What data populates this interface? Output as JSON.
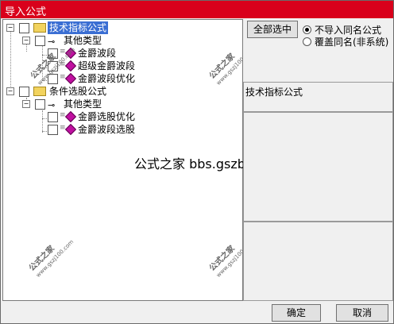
{
  "window": {
    "title": "导入公式"
  },
  "tree": {
    "groups": [
      {
        "label": "技术指标公式",
        "subgroup": "其他类型",
        "items": [
          "金爵波段",
          "超级金爵波段",
          "金爵波段优化"
        ]
      },
      {
        "label": "条件选股公式",
        "subgroup": "其他类型",
        "items": [
          "金爵选股优化",
          "金爵波段选股"
        ]
      }
    ]
  },
  "watermark": {
    "center": "公式之家 bbs.gszb.top",
    "stamp": "公式之家",
    "stamp_url": "www.gszj100.com"
  },
  "right": {
    "select_all": "全部选中",
    "option_skip": "不导入同名公式",
    "option_overwrite": "覆盖同名(非系统)",
    "info_label": "技术指标公式"
  },
  "footer": {
    "ok": "确定",
    "cancel": "取消"
  }
}
